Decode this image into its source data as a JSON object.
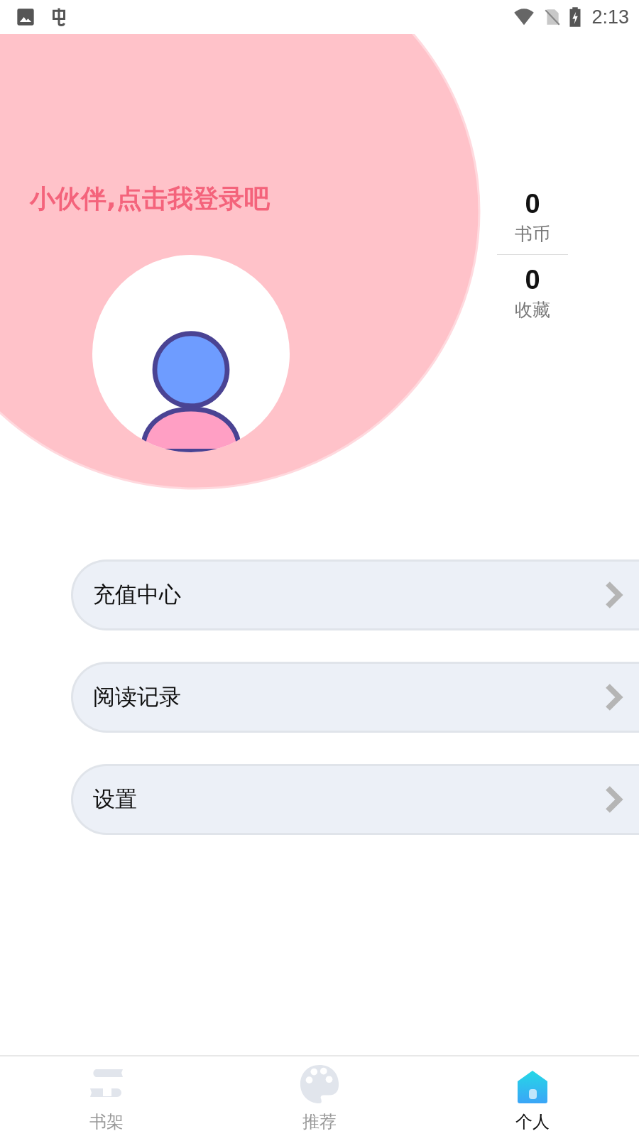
{
  "status_bar": {
    "time": "2:13"
  },
  "header": {
    "login_prompt": "小伙伴,点击我登录吧"
  },
  "stats": [
    {
      "value": "0",
      "label": "书币"
    },
    {
      "value": "0",
      "label": "收藏"
    }
  ],
  "menu": [
    {
      "label": "充值中心"
    },
    {
      "label": "阅读记录"
    },
    {
      "label": "设置"
    }
  ],
  "tabs": [
    {
      "label": "书架",
      "selected": false
    },
    {
      "label": "推荐",
      "selected": false
    },
    {
      "label": "个人",
      "selected": true
    }
  ]
}
